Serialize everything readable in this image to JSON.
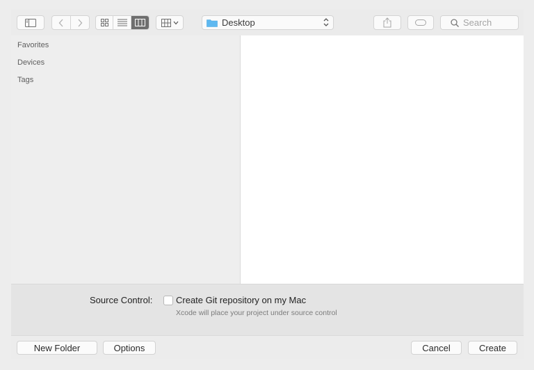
{
  "toolbar": {
    "path_label": "Desktop",
    "search_placeholder": "Search"
  },
  "sidebar": {
    "items": [
      {
        "label": "Favorites"
      },
      {
        "label": "Devices"
      },
      {
        "label": "Tags"
      }
    ]
  },
  "options": {
    "source_control_label": "Source Control:",
    "create_git_label": "Create Git repository on my Mac",
    "create_git_checked": false,
    "hint": "Xcode will place your project under source control"
  },
  "footer": {
    "new_folder_label": "New Folder",
    "options_label": "Options",
    "cancel_label": "Cancel",
    "create_label": "Create"
  },
  "colors": {
    "folder_icon": "#5eb8f0",
    "active_segment": "#6e6e6e"
  }
}
